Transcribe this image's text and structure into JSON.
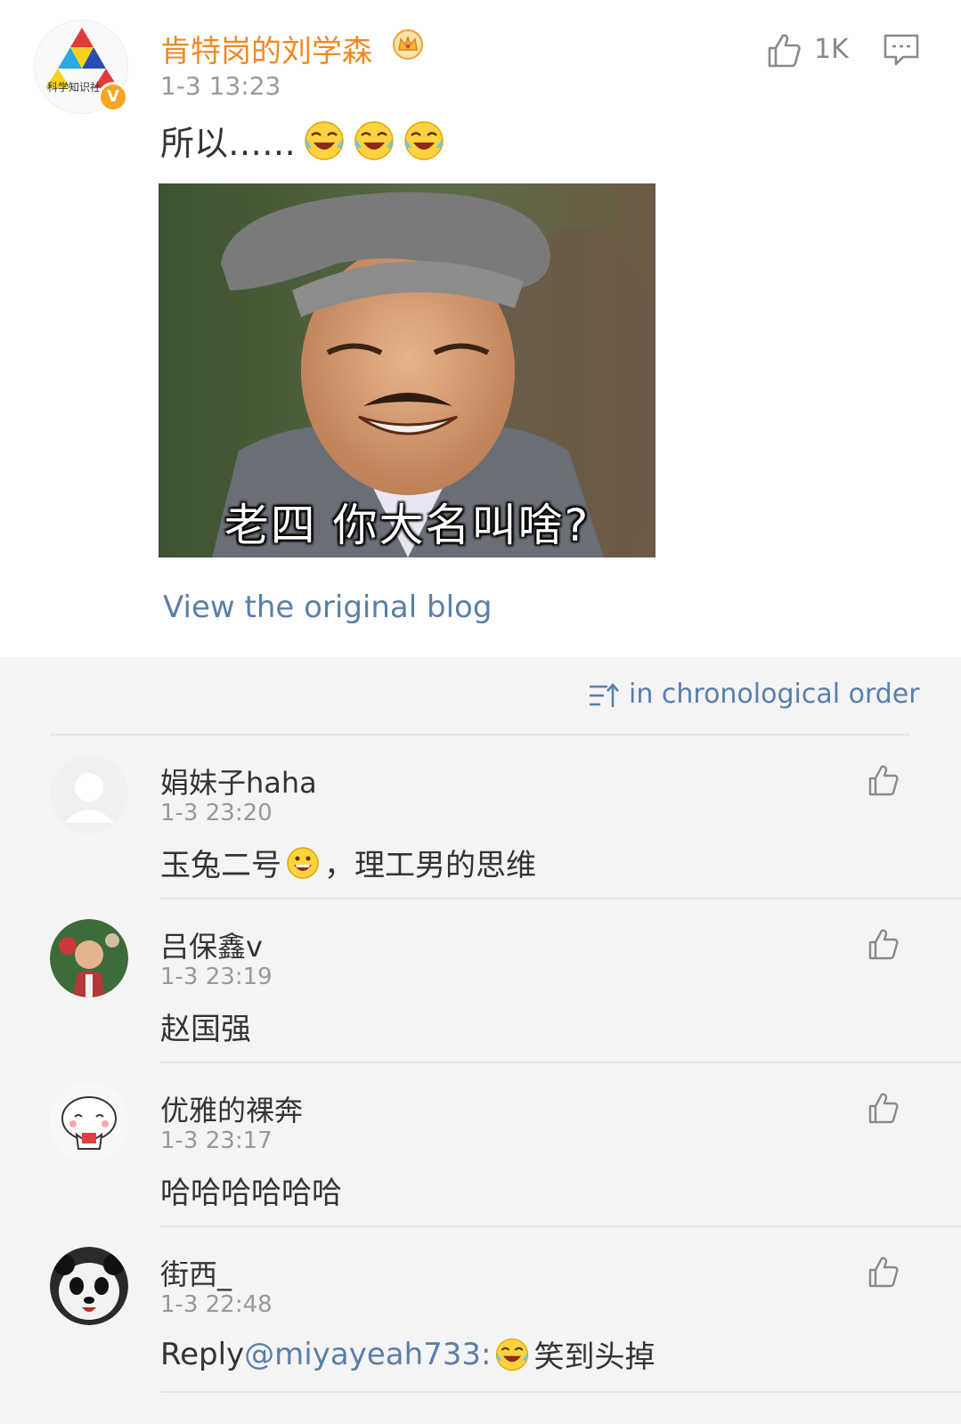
{
  "post": {
    "author": "肯特岗的刘学森",
    "avatar_text": "科学知识社",
    "verified_mark": "V",
    "time": "1-3 13:23",
    "like_count": "1K",
    "text": "所以……",
    "image_caption": "老四  你大名叫啥?",
    "view_original": "View the original blog"
  },
  "sort": {
    "label": "in chronological order"
  },
  "comments": [
    {
      "name": "娟妹子haha",
      "time": "1-3 23:20",
      "text_before": "玉兔二号",
      "text_after": "，理工男的思维"
    },
    {
      "name": "吕保鑫v",
      "time": "1-3 23:19",
      "text": "赵国强"
    },
    {
      "name": "优雅的裸奔",
      "time": "1-3 23:17",
      "text": "哈哈哈哈哈哈"
    },
    {
      "name": "街西_",
      "time": "1-3 22:48",
      "reply_prefix": "Reply",
      "mention": "@miyayeah733:",
      "text_after": "笑到头掉"
    }
  ],
  "colors": {
    "author_orange": "#f08a24",
    "link_blue": "#5a7fa8",
    "text_gray": "#999999",
    "background": "#f4f4f4"
  },
  "icons": [
    "crown-icon",
    "like-icon",
    "comment-icon",
    "sort-icon",
    "laughing-emoji",
    "grin-emoji"
  ]
}
